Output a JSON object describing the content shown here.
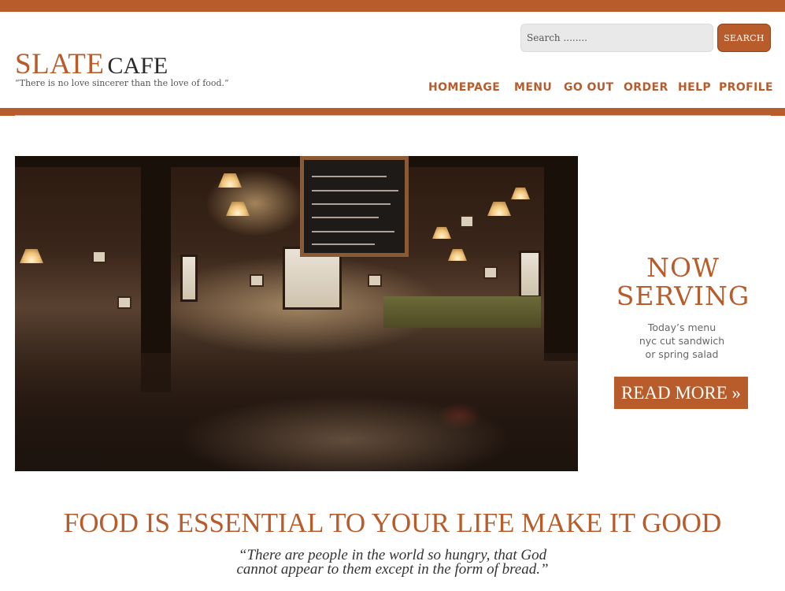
{
  "colors": {
    "accent": "#b85c2c",
    "search_bg": "#e9e9e9"
  },
  "header": {
    "logo_main": "SLATE",
    "logo_sub": "CAFE",
    "tagline": "“There is no love sincerer than the love of food.”"
  },
  "search": {
    "placeholder": "Search ........",
    "button_label": "SEARCH"
  },
  "nav": {
    "items": [
      {
        "label": "HOMEPAGE"
      },
      {
        "label": "MENU"
      },
      {
        "label": "GO OUT"
      },
      {
        "label": "ORDER"
      },
      {
        "label": "HELP"
      },
      {
        "label": "PROFILE"
      }
    ]
  },
  "hero": {
    "image_icon": "restaurant-interior-photo"
  },
  "promo": {
    "title_line1": "NOW",
    "title_line2": "SERVING",
    "text_line1": "Today’s menu",
    "text_line2": "nyc cut sandwich",
    "text_line3": "or spring salad",
    "button_label": "READ MORE »"
  },
  "section": {
    "title": "FOOD IS ESSENTIAL TO YOUR LIFE MAKE IT GOOD",
    "quote_line1": "“There are people in the world so hungry, that God",
    "quote_line2": "cannot appear to them except in the form of bread.”"
  }
}
